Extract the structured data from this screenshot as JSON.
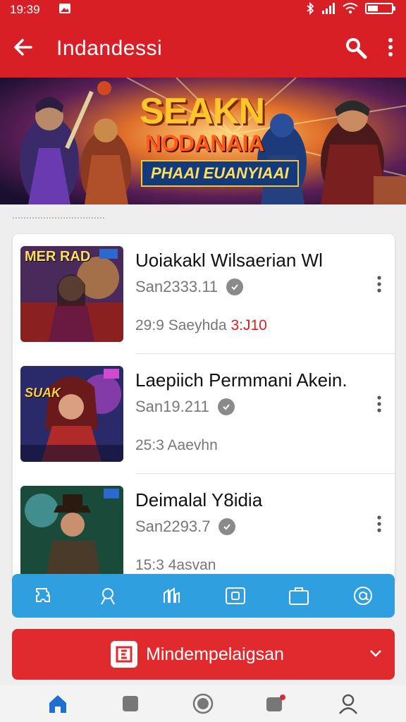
{
  "status": {
    "time": "19:39"
  },
  "appbar": {
    "title": "Indandessi"
  },
  "banner": {
    "title1": "SEAKN",
    "title2": "NODANAIA",
    "title3": "PHAAI EUANYIAAI"
  },
  "list": [
    {
      "title": "Uoiakakl Wilsaerian Wl",
      "meta": "San2333.11",
      "sub": "29:9 Saeyhda",
      "sub_highlight": "3:J10",
      "thumb_label": "MER RAD"
    },
    {
      "title": "Laepiich Permmani Akein.",
      "meta": "San19.211",
      "sub": "25:3 Aaevhn",
      "sub_highlight": "",
      "thumb_label": "SUAK"
    },
    {
      "title": "Deimalal Y8idia",
      "meta": "San2293.7",
      "sub": "15:3 4asvan",
      "sub_highlight": "",
      "thumb_label": ""
    }
  ],
  "action_button": {
    "label": "Mindempelaigsan"
  },
  "colors": {
    "primary": "#d81f26",
    "tabbar": "#2f9fe0"
  },
  "icons": {
    "tabbar": [
      "puzzle-icon",
      "search-icon",
      "trophy-icon",
      "camera-icon",
      "bag-icon",
      "at-icon"
    ],
    "bottomnav": [
      "home-icon",
      "library-icon",
      "record-icon",
      "notifications-icon",
      "profile-icon"
    ]
  }
}
